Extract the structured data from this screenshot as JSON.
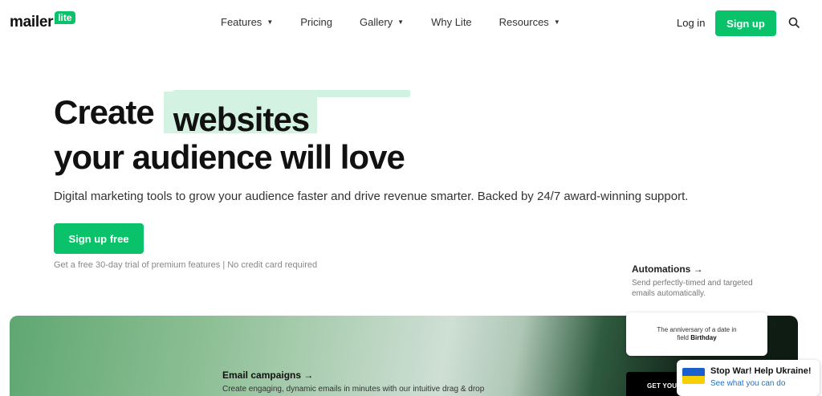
{
  "header": {
    "logo_text": "mailer",
    "logo_badge": "lite",
    "nav": [
      {
        "label": "Features",
        "dropdown": true
      },
      {
        "label": "Pricing",
        "dropdown": false
      },
      {
        "label": "Gallery",
        "dropdown": true
      },
      {
        "label": "Why Lite",
        "dropdown": false
      },
      {
        "label": "Resources",
        "dropdown": true
      }
    ],
    "login_label": "Log in",
    "signup_label": "Sign up",
    "search_icon": "search-icon"
  },
  "hero": {
    "line1_prefix": "Create",
    "line1_highlight": "websites",
    "line2": "your audience will love",
    "subtitle": "Digital marketing tools to grow your audience faster and drive revenue smarter. Backed by 24/7 award-winning support.",
    "cta_label": "Sign up free",
    "trial_note": "Get a free 30-day trial of premium features | No credit card required"
  },
  "features": {
    "automations": {
      "title": "Automations →",
      "description": "Send perfectly-timed and targeted emails automatically."
    },
    "anniversary_card": {
      "line1": "The anniversary of a date in",
      "line2_prefix": "field",
      "line2_bold": "Birthday"
    },
    "email_campaigns": {
      "title": "Email campaigns →",
      "description": "Create engaging, dynamic emails in minutes with our intuitive drag & drop"
    },
    "dark_card_text": "GET YOUR"
  },
  "ukraine_widget": {
    "title": "Stop War! Help Ukraine!",
    "link": "See what you can do"
  },
  "colors": {
    "brand_green": "#09c269",
    "highlight_green": "#d4f2e2",
    "link_blue": "#1a73c8"
  }
}
